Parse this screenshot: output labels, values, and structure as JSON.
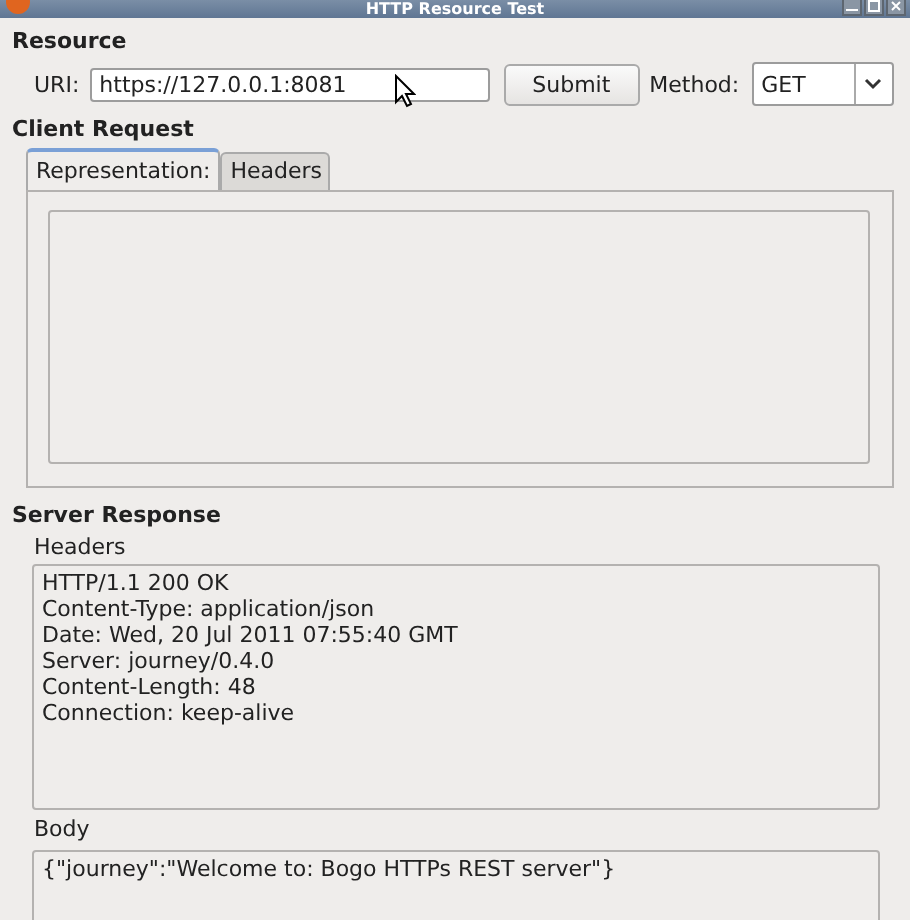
{
  "window": {
    "title": "HTTP Resource Test"
  },
  "resource": {
    "heading": "Resource",
    "uri_label": "URI:",
    "uri_value": "https://127.0.0.1:8081",
    "submit": "Submit",
    "method_label": "Method:",
    "method_value": "GET"
  },
  "client_request": {
    "heading": "Client Request",
    "tabs": [
      {
        "label": "Representation:",
        "selected": true
      },
      {
        "label": "Headers",
        "selected": false
      }
    ]
  },
  "server_response": {
    "heading": "Server Response",
    "headers_label": "Headers",
    "headers_lines": [
      "HTTP/1.1 200 OK",
      "Content-Type: application/json",
      "Date: Wed, 20 Jul 2011 07:55:40 GMT",
      "Server: journey/0.4.0",
      "Content-Length: 48",
      "Connection: keep-alive"
    ],
    "body_label": "Body",
    "body_text": "{\"journey\":\"Welcome to: Bogo HTTPs REST server\"}"
  }
}
